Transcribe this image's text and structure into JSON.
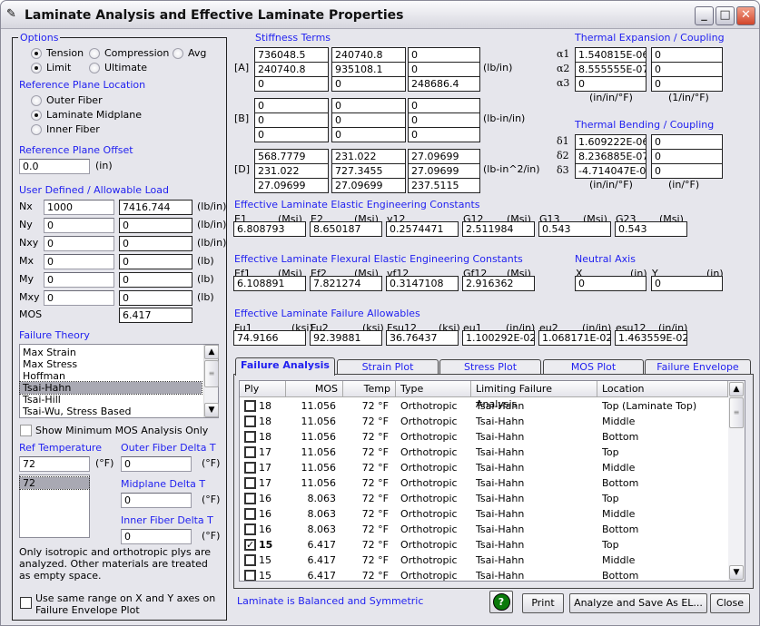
{
  "window": {
    "title": "Laminate Analysis and Effective Laminate Properties",
    "minimize": "_",
    "maximize": "□",
    "close": "✕"
  },
  "options": {
    "label": "Options",
    "tension": "Tension",
    "compression": "Compression",
    "avg": "Avg",
    "limit": "Limit",
    "ultimate": "Ultimate",
    "selected_load": "Tension",
    "selected_level": "Limit"
  },
  "ref_plane": {
    "label": "Reference Plane Location",
    "outer": "Outer Fiber",
    "mid": "Laminate Midplane",
    "inner": "Inner Fiber",
    "selected": "Laminate Midplane"
  },
  "offset": {
    "label": "Reference Plane Offset",
    "value": "0.0",
    "unit": "(in)"
  },
  "loads": {
    "label": "User Defined / Allowable Load",
    "rows": [
      {
        "name": "Nx",
        "user": "1000",
        "allow": "7416.744",
        "unit": "(lb/in)"
      },
      {
        "name": "Ny",
        "user": "0",
        "allow": "0",
        "unit": "(lb/in)"
      },
      {
        "name": "Nxy",
        "user": "0",
        "allow": "0",
        "unit": "(lb/in)"
      },
      {
        "name": "Mx",
        "user": "0",
        "allow": "0",
        "unit": "(lb)"
      },
      {
        "name": "My",
        "user": "0",
        "allow": "0",
        "unit": "(lb)"
      },
      {
        "name": "Mxy",
        "user": "0",
        "allow": "0",
        "unit": "(lb)"
      }
    ],
    "mos_label": "MOS",
    "mos": "6.417"
  },
  "failure_theory": {
    "label": "Failure Theory",
    "items": [
      "Max Strain",
      "Max Stress",
      "Hoffman",
      "Tsai-Hahn",
      "Tsai-Hill",
      "Tsai-Wu, Stress Based"
    ],
    "selected": "Tsai-Hahn"
  },
  "show_min_mos": {
    "label": "Show Minimum MOS Analysis Only",
    "checked": false
  },
  "ref_temp": {
    "label": "Ref Temperature",
    "value": "72",
    "unit": "(°F)",
    "list": [
      "72"
    ]
  },
  "outer_dt": {
    "label": "Outer Fiber Delta T",
    "value": "0",
    "unit": "(°F)"
  },
  "mid_dt": {
    "label": "Midplane Delta T",
    "value": "0",
    "unit": "(°F)"
  },
  "inner_dt": {
    "label": "Inner Fiber Delta T",
    "value": "0",
    "unit": "(°F)"
  },
  "note": "Only isotropic and orthotropic plys are analyzed.  Other materials are treated as empty space.",
  "same_range": {
    "label": "Use same range on X and Y axes on Failure Envelope Plot",
    "checked": false
  },
  "stiffness": {
    "label": "Stiffness Terms",
    "A": {
      "label": "[A]",
      "unit": "(lb/in)",
      "values": [
        [
          "736048.5",
          "240740.8",
          "0"
        ],
        [
          "240740.8",
          "935108.1",
          "0"
        ],
        [
          "0",
          "0",
          "248686.4"
        ]
      ]
    },
    "B": {
      "label": "[B]",
      "unit": "(lb-in/in)",
      "values": [
        [
          "0",
          "0",
          "0"
        ],
        [
          "0",
          "0",
          "0"
        ],
        [
          "0",
          "0",
          "0"
        ]
      ]
    },
    "D": {
      "label": "[D]",
      "unit": "(lb-in^2/in)",
      "values": [
        [
          "568.7779",
          "231.022",
          "27.09699"
        ],
        [
          "231.022",
          "727.3455",
          "27.09699"
        ],
        [
          "27.09699",
          "27.09699",
          "237.5115"
        ]
      ]
    }
  },
  "thermal_exp": {
    "label": "Thermal Expansion / Coupling",
    "rows": [
      {
        "name": "α1",
        "a": "1.540815E-06",
        "b": "0"
      },
      {
        "name": "α2",
        "a": "8.555555E-07",
        "b": "0"
      },
      {
        "name": "α3",
        "a": "0",
        "b": "0"
      }
    ],
    "unit_a": "(in/in/°F)",
    "unit_b": "(1/in/°F)"
  },
  "thermal_bend": {
    "label": "Thermal Bending / Coupling",
    "rows": [
      {
        "name": "δ1",
        "a": "1.609222E-06",
        "b": "0"
      },
      {
        "name": "δ2",
        "a": "8.236885E-07",
        "b": "0"
      },
      {
        "name": "δ3",
        "a": "-4.714047E-07",
        "b": "0"
      }
    ],
    "unit_a": "(in/in/°F)",
    "unit_b": "(in/°F)"
  },
  "elastic": {
    "label": "Effective Laminate Elastic Engineering Constants",
    "fields": [
      {
        "name": "E1",
        "unit": "(Msi)",
        "value": "6.808793"
      },
      {
        "name": "E2",
        "unit": "(Msi)",
        "value": "8.650187"
      },
      {
        "name": "v12",
        "unit": "",
        "value": "0.2574471"
      },
      {
        "name": "G12",
        "unit": "(Msi)",
        "value": "2.511984"
      },
      {
        "name": "G13",
        "unit": "(Msi)",
        "value": "0.543"
      },
      {
        "name": "G23",
        "unit": "(Msi)",
        "value": "0.543"
      }
    ]
  },
  "flexural": {
    "label": "Effective Laminate Flexural Elastic Engineering Constants",
    "fields": [
      {
        "name": "Ef1",
        "unit": "(Msi)",
        "value": "6.108891"
      },
      {
        "name": "Ef2",
        "unit": "(Msi)",
        "value": "7.821274"
      },
      {
        "name": "vf12",
        "unit": "",
        "value": "0.3147108"
      },
      {
        "name": "Gf12",
        "unit": "(Msi)",
        "value": "2.916362"
      }
    ]
  },
  "neutral": {
    "label": "Neutral Axis",
    "fields": [
      {
        "name": "X",
        "unit": "(in)",
        "value": "0"
      },
      {
        "name": "Y",
        "unit": "(in)",
        "value": "0"
      }
    ]
  },
  "allowables": {
    "label": "Effective Laminate Failure Allowables",
    "fields": [
      {
        "name": "Fu1",
        "unit": "(ksi)",
        "value": "74.9166"
      },
      {
        "name": "Fu2",
        "unit": "(ksi)",
        "value": "92.39881"
      },
      {
        "name": "Fsu12",
        "unit": "(ksi)",
        "value": "36.76437"
      },
      {
        "name": "eu1",
        "unit": "(in/in)",
        "value": "1.100292E-02"
      },
      {
        "name": "eu2",
        "unit": "(in/in)",
        "value": "1.068171E-02"
      },
      {
        "name": "esu12",
        "unit": "(in/in)",
        "value": "1.463559E-02"
      }
    ]
  },
  "tabs": [
    "Failure Analysis",
    "Strain Plot",
    "Stress Plot",
    "MOS Plot",
    "Failure Envelope"
  ],
  "active_tab": "Failure Analysis",
  "table": {
    "columns": [
      "Ply",
      "MOS",
      "Temp",
      "Type",
      "Limiting Failure Analysis",
      "Location"
    ],
    "rows": [
      {
        "checked": false,
        "ply": "18",
        "mos": "11.056",
        "temp": "72 °F",
        "type": "Orthotropic",
        "analysis": "Tsai-Hahn",
        "location": "Top (Laminate Top)"
      },
      {
        "checked": false,
        "ply": "18",
        "mos": "11.056",
        "temp": "72 °F",
        "type": "Orthotropic",
        "analysis": "Tsai-Hahn",
        "location": "Middle"
      },
      {
        "checked": false,
        "ply": "18",
        "mos": "11.056",
        "temp": "72 °F",
        "type": "Orthotropic",
        "analysis": "Tsai-Hahn",
        "location": "Bottom"
      },
      {
        "checked": false,
        "ply": "17",
        "mos": "11.056",
        "temp": "72 °F",
        "type": "Orthotropic",
        "analysis": "Tsai-Hahn",
        "location": "Top"
      },
      {
        "checked": false,
        "ply": "17",
        "mos": "11.056",
        "temp": "72 °F",
        "type": "Orthotropic",
        "analysis": "Tsai-Hahn",
        "location": "Middle"
      },
      {
        "checked": false,
        "ply": "17",
        "mos": "11.056",
        "temp": "72 °F",
        "type": "Orthotropic",
        "analysis": "Tsai-Hahn",
        "location": "Bottom"
      },
      {
        "checked": false,
        "ply": "16",
        "mos": "8.063",
        "temp": "72 °F",
        "type": "Orthotropic",
        "analysis": "Tsai-Hahn",
        "location": "Top"
      },
      {
        "checked": false,
        "ply": "16",
        "mos": "8.063",
        "temp": "72 °F",
        "type": "Orthotropic",
        "analysis": "Tsai-Hahn",
        "location": "Middle"
      },
      {
        "checked": false,
        "ply": "16",
        "mos": "8.063",
        "temp": "72 °F",
        "type": "Orthotropic",
        "analysis": "Tsai-Hahn",
        "location": "Bottom"
      },
      {
        "checked": true,
        "ply": "15",
        "mos": "6.417",
        "temp": "72 °F",
        "type": "Orthotropic",
        "analysis": "Tsai-Hahn",
        "location": "Top"
      },
      {
        "checked": false,
        "ply": "15",
        "mos": "6.417",
        "temp": "72 °F",
        "type": "Orthotropic",
        "analysis": "Tsai-Hahn",
        "location": "Middle"
      },
      {
        "checked": false,
        "ply": "15",
        "mos": "6.417",
        "temp": "72 °F",
        "type": "Orthotropic",
        "analysis": "Tsai-Hahn",
        "location": "Bottom"
      }
    ]
  },
  "status": "Laminate is Balanced and Symmetric",
  "buttons": {
    "help": "?",
    "print": "Print",
    "analyze": "Analyze and Save As EL...",
    "close": "Close"
  },
  "colors": {
    "label": "#1f1ff0",
    "help_green": "#0a7a0a"
  }
}
